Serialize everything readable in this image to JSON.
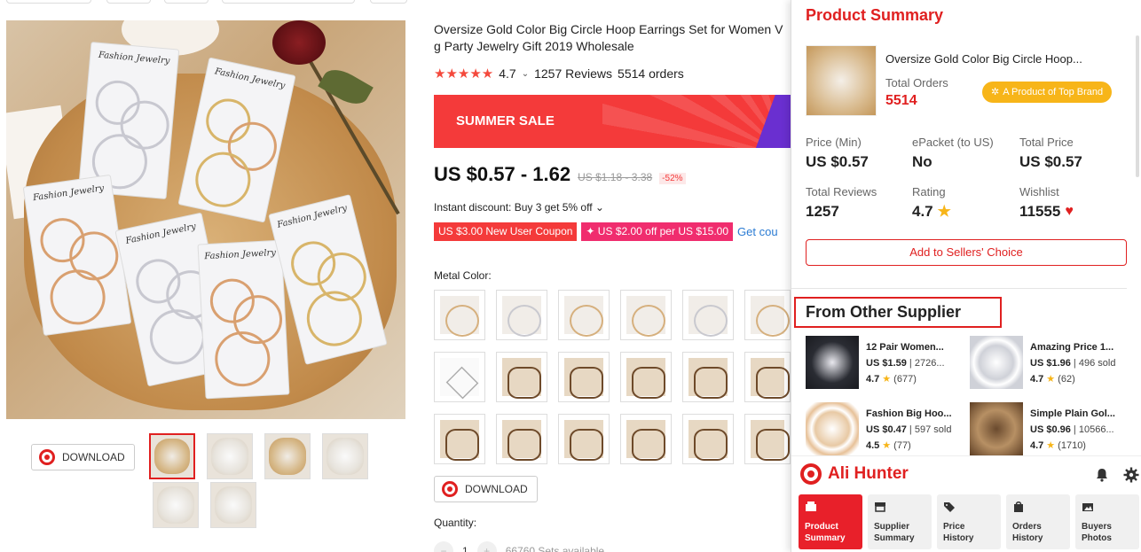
{
  "product": {
    "title_line1": "Oversize Gold Color Big Circle Hoop Earrings Set for Women V",
    "title_line2": "g Party Jewelry Gift 2019 Wholesale",
    "stars": "★★★★★",
    "rating": "4.7",
    "reviews": "1257 Reviews",
    "orders": "5514 orders",
    "banner_text": "SUMMER SALE",
    "price": "US $0.57 - 1.62",
    "old_price": "US $1.18 - 3.38",
    "discount": "-52%",
    "instant_discount": "Instant discount: Buy 3 get 5% off ⌄",
    "coupon1": "US $3.00 New User Coupon",
    "coupon2": "✦ US $2.00 off per US $15.00",
    "get_coupon": "Get cou",
    "metal_color_label": "Metal Color:",
    "quantity_label": "Quantity:",
    "qty_value": "1",
    "qty_available": "66760 Sets available",
    "download_label": "DOWNLOAD"
  },
  "card_label": "Fashion Jewelry",
  "panel": {
    "title": "Product Summary",
    "product_name": "Oversize Gold Color Big Circle Hoop...",
    "total_orders_label": "Total Orders",
    "total_orders_value": "5514",
    "brand_badge": "A Product of Top Brand",
    "stats": [
      {
        "k": "Price (Min)",
        "v": "US $0.57"
      },
      {
        "k": "ePacket (to US)",
        "v": "No"
      },
      {
        "k": "Total Price",
        "v": "US $0.57"
      },
      {
        "k": "Total Reviews",
        "v": "1257"
      },
      {
        "k": "Rating",
        "v": "4.7"
      },
      {
        "k": "Wishlist",
        "v": "11555"
      }
    ],
    "sellers_choice_label": "Add to Sellers' Choice",
    "other_supplier_title": "From Other Supplier",
    "suppliers": [
      {
        "name": "12 Pair Women...",
        "price": "US $1.59",
        "sold": "2726...",
        "rating": "4.7",
        "count": "(677)"
      },
      {
        "name": "Amazing Price 1...",
        "price": "US $1.96",
        "sold": "496 sold",
        "rating": "4.7",
        "count": "(62)"
      },
      {
        "name": "Fashion Big Hoo...",
        "price": "US $0.47",
        "sold": "597 sold",
        "rating": "4.5",
        "count": "(77)"
      },
      {
        "name": "Simple Plain Gol...",
        "price": "US $0.96",
        "sold": "10566...",
        "rating": "4.7",
        "count": "(1710)"
      }
    ]
  },
  "footer": {
    "brand": "Ali Hunter",
    "tabs": [
      {
        "l1": "Product",
        "l2": "Summary"
      },
      {
        "l1": "Supplier",
        "l2": "Summary"
      },
      {
        "l1": "Price",
        "l2": "History"
      },
      {
        "l1": "Orders",
        "l2": "History"
      },
      {
        "l1": "Buyers",
        "l2": "Photos"
      }
    ]
  },
  "colors": {
    "accent": "#e02020",
    "gold": "#f7b519",
    "sale": "#f43a3a"
  }
}
